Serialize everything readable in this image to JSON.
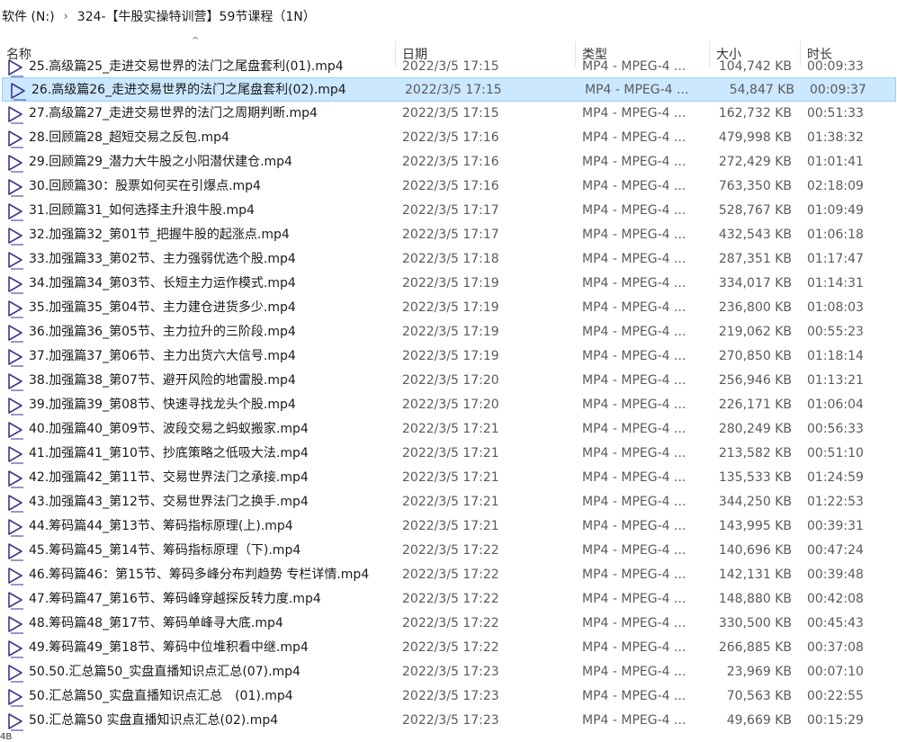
{
  "breadcrumb": [
    "软件 (N:)",
    "324-【牛股实操特训营】59节课程（1N）"
  ],
  "breadcrumb_sep": "›",
  "columns": {
    "name": "名称",
    "date": "日期",
    "type": "类型",
    "size": "大小",
    "duration": "时长"
  },
  "sort_arrow": "^",
  "partial_row": {
    "name": "25.高级篇25_走进交易世界的法门之尾盘套利(01).mp4",
    "date": "2022/3/5 17:15",
    "type": "MP4 - MPEG-4 ...",
    "size": "104,742 KB",
    "duration": "00:09:33"
  },
  "files": [
    {
      "name": "26.高级篇26_走进交易世界的法门之尾盘套利(02).mp4",
      "date": "2022/3/5 17:15",
      "type": "MP4 - MPEG-4 ...",
      "size": "54,847 KB",
      "duration": "00:09:37"
    },
    {
      "name": "27.高级篇27_走进交易世界的法门之周期判断.mp4",
      "date": "2022/3/5 17:15",
      "type": "MP4 - MPEG-4 ...",
      "size": "162,732 KB",
      "duration": "00:51:33"
    },
    {
      "name": "28.回顾篇28_超短交易之反包.mp4",
      "date": "2022/3/5 17:16",
      "type": "MP4 - MPEG-4 ...",
      "size": "479,998 KB",
      "duration": "01:38:32"
    },
    {
      "name": "29.回顾篇29_潜力大牛股之小阳潜伏建仓.mp4",
      "date": "2022/3/5 17:16",
      "type": "MP4 - MPEG-4 ...",
      "size": "272,429 KB",
      "duration": "01:01:41"
    },
    {
      "name": "30.回顾篇30：股票如何买在引爆点.mp4",
      "date": "2022/3/5 17:16",
      "type": "MP4 - MPEG-4 ...",
      "size": "763,350 KB",
      "duration": "02:18:09"
    },
    {
      "name": "31.回顾篇31_如何选择主升浪牛股.mp4",
      "date": "2022/3/5 17:17",
      "type": "MP4 - MPEG-4 ...",
      "size": "528,767 KB",
      "duration": "01:09:49"
    },
    {
      "name": "32.加强篇32_第01节_把握牛股的起涨点.mp4",
      "date": "2022/3/5 17:17",
      "type": "MP4 - MPEG-4 ...",
      "size": "432,543 KB",
      "duration": "01:06:18"
    },
    {
      "name": "33.加强篇33_第02节、主力强弱优选个股.mp4",
      "date": "2022/3/5 17:18",
      "type": "MP4 - MPEG-4 ...",
      "size": "287,351 KB",
      "duration": "01:17:47"
    },
    {
      "name": "34.加强篇34_第03节、长短主力运作模式.mp4",
      "date": "2022/3/5 17:19",
      "type": "MP4 - MPEG-4 ...",
      "size": "334,017 KB",
      "duration": "01:14:31"
    },
    {
      "name": "35.加强篇35_第04节、主力建仓进货多少.mp4",
      "date": "2022/3/5 17:19",
      "type": "MP4 - MPEG-4 ...",
      "size": "236,800 KB",
      "duration": "01:08:03"
    },
    {
      "name": "36.加强篇36_第05节、主力拉升的三阶段.mp4",
      "date": "2022/3/5 17:19",
      "type": "MP4 - MPEG-4 ...",
      "size": "219,062 KB",
      "duration": "00:55:23"
    },
    {
      "name": "37.加强篇37_第06节、主力出货六大信号.mp4",
      "date": "2022/3/5 17:19",
      "type": "MP4 - MPEG-4 ...",
      "size": "270,850 KB",
      "duration": "01:18:14"
    },
    {
      "name": "38.加强篇38_第07节、避开风险的地雷股.mp4",
      "date": "2022/3/5 17:20",
      "type": "MP4 - MPEG-4 ...",
      "size": "256,946 KB",
      "duration": "01:13:21"
    },
    {
      "name": "39.加强篇39_第08节、快速寻找龙头个股.mp4",
      "date": "2022/3/5 17:20",
      "type": "MP4 - MPEG-4 ...",
      "size": "226,171 KB",
      "duration": "01:06:04"
    },
    {
      "name": "40.加强篇40_第09节、波段交易之蚂蚁搬家.mp4",
      "date": "2022/3/5 17:21",
      "type": "MP4 - MPEG-4 ...",
      "size": "280,249 KB",
      "duration": "00:56:33"
    },
    {
      "name": "41.加强篇41_第10节、抄底策略之低吸大法.mp4",
      "date": "2022/3/5 17:21",
      "type": "MP4 - MPEG-4 ...",
      "size": "213,582 KB",
      "duration": "00:51:10"
    },
    {
      "name": "42.加强篇42_第11节、交易世界法门之承接.mp4",
      "date": "2022/3/5 17:21",
      "type": "MP4 - MPEG-4 ...",
      "size": "135,533 KB",
      "duration": "01:24:59"
    },
    {
      "name": "43.加强篇43_第12节、交易世界法门之换手.mp4",
      "date": "2022/3/5 17:21",
      "type": "MP4 - MPEG-4 ...",
      "size": "344,250 KB",
      "duration": "01:22:53"
    },
    {
      "name": "44.筹码篇44_第13节、筹码指标原理(上).mp4",
      "date": "2022/3/5 17:21",
      "type": "MP4 - MPEG-4 ...",
      "size": "143,995 KB",
      "duration": "00:39:31"
    },
    {
      "name": "45.筹码篇45_第14节、筹码指标原理（下).mp4",
      "date": "2022/3/5 17:22",
      "type": "MP4 - MPEG-4 ...",
      "size": "140,696 KB",
      "duration": "00:47:24"
    },
    {
      "name": "46.筹码篇46：第15节、筹码多峰分布判趋势 专栏详情.mp4",
      "date": "2022/3/5 17:22",
      "type": "MP4 - MPEG-4 ...",
      "size": "142,131 KB",
      "duration": "00:39:48"
    },
    {
      "name": "47.筹码篇47_第16节、筹码峰穿越探反转力度.mp4",
      "date": "2022/3/5 17:22",
      "type": "MP4 - MPEG-4 ...",
      "size": "148,880 KB",
      "duration": "00:42:08"
    },
    {
      "name": "48.筹码篇48_第17节、筹码单峰寻大底.mp4",
      "date": "2022/3/5 17:22",
      "type": "MP4 - MPEG-4 ...",
      "size": "330,500 KB",
      "duration": "00:45:43"
    },
    {
      "name": "49.筹码篇49_第18节、筹码中位堆积看中继.mp4",
      "date": "2022/3/5 17:22",
      "type": "MP4 - MPEG-4 ...",
      "size": "266,885 KB",
      "duration": "00:37:08"
    },
    {
      "name": "50.50.汇总篇50_实盘直播知识点汇总(07).mp4",
      "date": "2022/3/5 17:23",
      "type": "MP4 - MPEG-4 ...",
      "size": "23,969 KB",
      "duration": "00:07:10"
    },
    {
      "name": "50.汇总篇50_实盘直播知识点汇总　(01).mp4",
      "date": "2022/3/5 17:23",
      "type": "MP4 - MPEG-4 ...",
      "size": "70,563 KB",
      "duration": "00:22:55"
    },
    {
      "name": "50.汇总篇50 实盘直播知识点汇总(02).mp4",
      "date": "2022/3/5 17:23",
      "type": "MP4 - MPEG-4 ...",
      "size": "49,669 KB",
      "duration": "00:15:29"
    }
  ],
  "selected_index": 0,
  "status_cut": "4B",
  "icon": "video-file-icon",
  "colors": {
    "selected_bg": "#cce8ff",
    "selected_border": "#99d1ff",
    "icon_stroke": "#3a3a8c"
  }
}
